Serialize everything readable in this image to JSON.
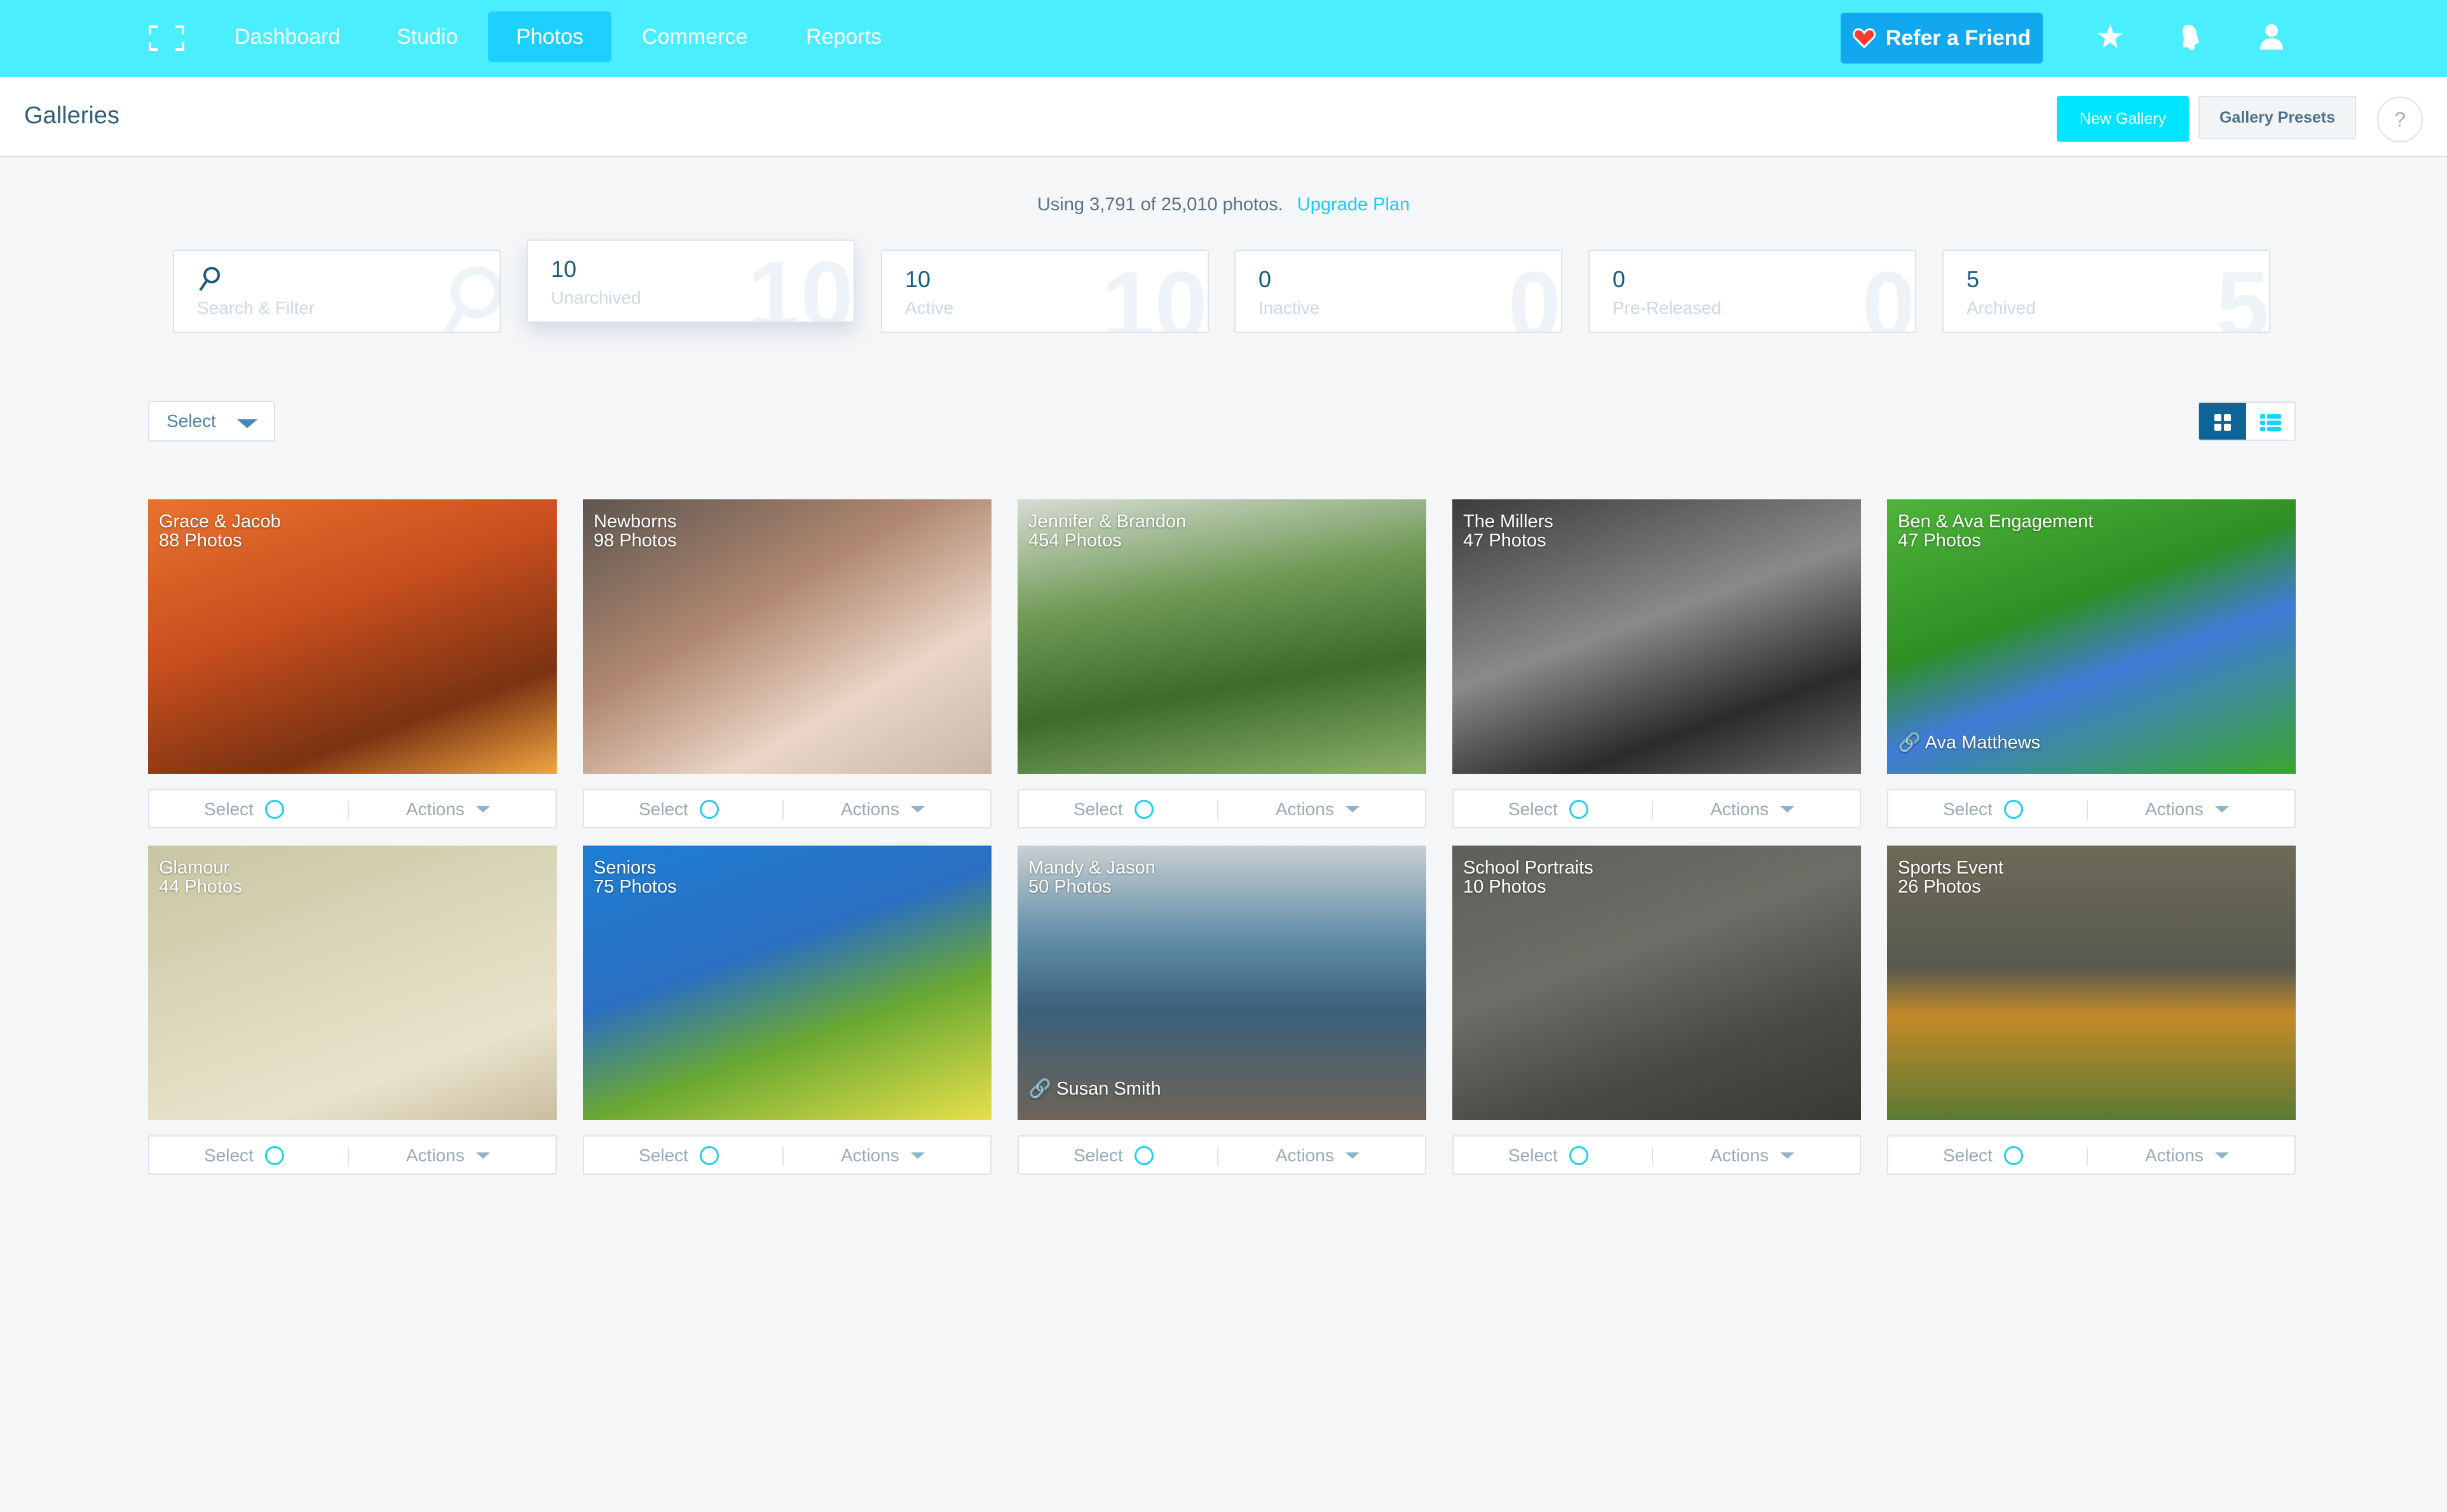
{
  "nav": {
    "logo": "focus-frame-icon",
    "items": [
      {
        "label": "Dashboard",
        "active": false
      },
      {
        "label": "Studio",
        "active": false
      },
      {
        "label": "Photos",
        "active": true
      },
      {
        "label": "Commerce",
        "active": false
      },
      {
        "label": "Reports",
        "active": false
      }
    ],
    "refer_label": "Refer a Friend",
    "icons": [
      "star-icon",
      "bell-icon",
      "user-icon"
    ],
    "colors": {
      "bar": "#4aeeff",
      "active": "#1ed0ff",
      "refer": "#12a8ef"
    }
  },
  "header": {
    "title": "Galleries",
    "new_gallery_label": "New Gallery",
    "gallery_presets_label": "Gallery Presets",
    "help_label": "?"
  },
  "usage": {
    "text": "Using 3,791 of 25,010 photos.",
    "link": "Upgrade Plan"
  },
  "filters": {
    "search_label": "Search & Filter",
    "stats": [
      {
        "count": "10",
        "label": "Unarchived",
        "active": true
      },
      {
        "count": "10",
        "label": "Active",
        "active": false
      },
      {
        "count": "0",
        "label": "Inactive",
        "active": false
      },
      {
        "count": "0",
        "label": "Pre-Released",
        "active": false
      },
      {
        "count": "5",
        "label": "Archived",
        "active": false
      }
    ]
  },
  "toolbar": {
    "select_label": "Select",
    "view_modes": [
      "grid-view",
      "list-view"
    ],
    "active_view": "grid-view"
  },
  "card_labels": {
    "select": "Select",
    "actions": "Actions"
  },
  "galleries": [
    {
      "name": "Grace & Jacob",
      "photos": "88 Photos",
      "client": ""
    },
    {
      "name": "Newborns",
      "photos": "98 Photos",
      "client": ""
    },
    {
      "name": "Jennifer & Brandon",
      "photos": "454 Photos",
      "client": ""
    },
    {
      "name": "The Millers",
      "photos": "47 Photos",
      "client": ""
    },
    {
      "name": "Ben & Ava Engagement",
      "photos": "47 Photos",
      "client": "Ava Matthews"
    },
    {
      "name": "Glamour",
      "photos": "44 Photos",
      "client": ""
    },
    {
      "name": "Seniors",
      "photos": "75 Photos",
      "client": ""
    },
    {
      "name": "Mandy & Jason",
      "photos": "50 Photos",
      "client": "Susan Smith"
    },
    {
      "name": "School Portraits",
      "photos": "10 Photos",
      "client": ""
    },
    {
      "name": "Sports Event",
      "photos": "26 Photos",
      "client": ""
    }
  ]
}
